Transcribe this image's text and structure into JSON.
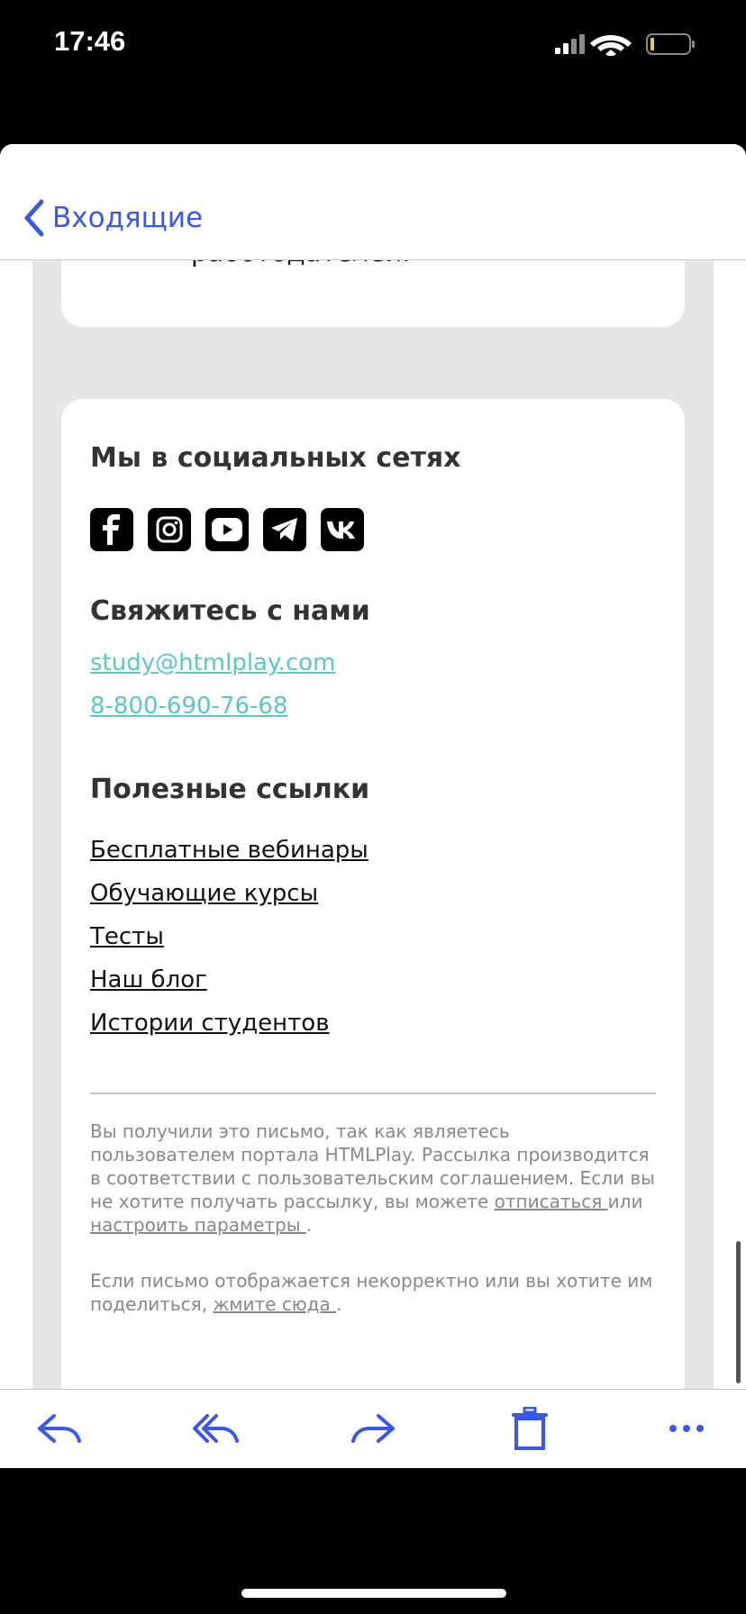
{
  "status_bar": {
    "time": "17:46"
  },
  "nav": {
    "back_label": "Входящие"
  },
  "email": {
    "prev_card_fragment": "работодателей.",
    "social": {
      "title": "Мы в социальных сетях",
      "icons": [
        "facebook-icon",
        "instagram-icon",
        "youtube-icon",
        "telegram-icon",
        "vk-icon"
      ]
    },
    "contact": {
      "title": "Свяжитесь с нами",
      "email": "study@htmlplay.com",
      "phone": "8-800-690-76-68"
    },
    "links": {
      "title": "Полезные ссылки",
      "items": [
        "Бесплатные вебинары",
        "Обучающие курсы",
        "Тесты",
        "Наш блог",
        "Истории студентов"
      ]
    },
    "footer": {
      "p1_text": "Вы получили это письмо, так как являетесь пользователем портала HTMLPlay. Рассылка производится в соответствии с пользовательским соглашением. Если вы не хотите получать рассылку, вы можете ",
      "unsubscribe_link": "отписаться ",
      "p1_or": "или ",
      "settings_link": "настроить параметры ",
      "p1_end": ".",
      "p2_text": "Если письмо отображается некорректно или вы хотите им поделиться, ",
      "here_link": "жмите сюда ",
      "p2_end": "."
    }
  },
  "colors": {
    "accent": "#3a58e8",
    "link_teal": "#5cc6c4",
    "email_bg": "#e6e6e6"
  }
}
